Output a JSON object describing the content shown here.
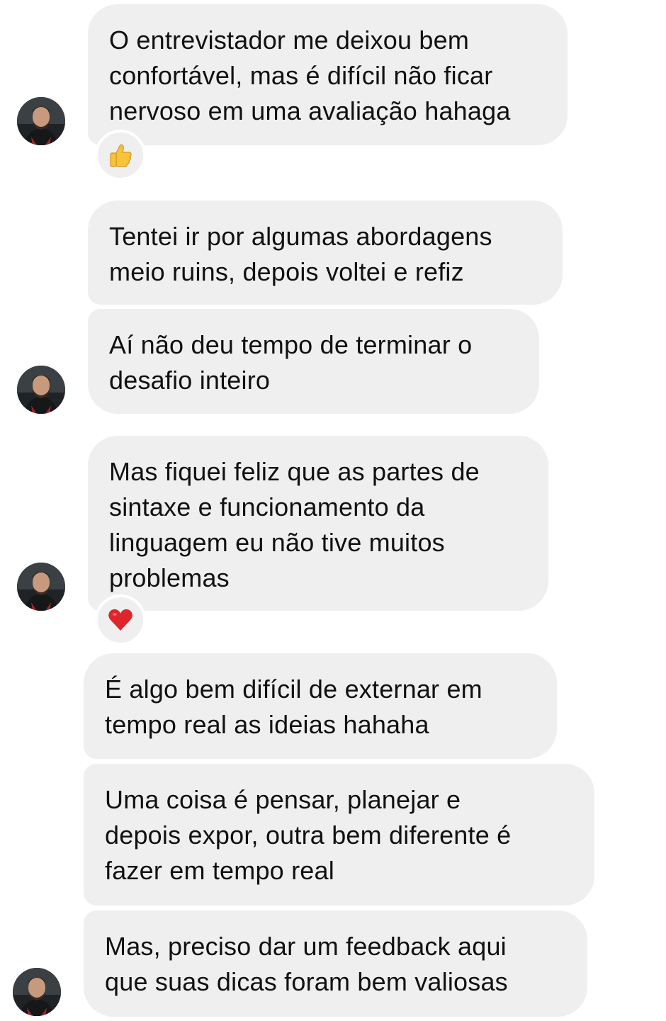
{
  "messages": [
    {
      "text": "O entrevistador me deixou bem\nconfortável, mas é difícil não ficar\nnervoso em uma avaliação hahaga"
    },
    {
      "text": "Tentei ir por algumas abordagens\nmeio ruins, depois voltei e refiz"
    },
    {
      "text": "Aí não deu tempo de terminar o\ndesafio inteiro"
    },
    {
      "text": "Mas fiquei feliz que as partes de\nsintaxe e funcionamento da\nlinguagem eu não tive muitos\nproblemas"
    },
    {
      "text": "É algo bem difícil de externar em\ntempo real as ideias hahaha"
    },
    {
      "text": "Uma coisa é pensar, planejar e\ndepois expor, outra bem diferente é\nfazer em tempo real"
    },
    {
      "text": "Mas, preciso dar um feedback aqui\nque suas dicas foram bem valiosas"
    }
  ],
  "reactions": [
    {
      "icon": "thumbs-up-icon"
    },
    {
      "icon": "red-heart-icon"
    }
  ],
  "colors": {
    "bubble": "#efefef",
    "text": "#111111",
    "background": "#ffffff"
  }
}
